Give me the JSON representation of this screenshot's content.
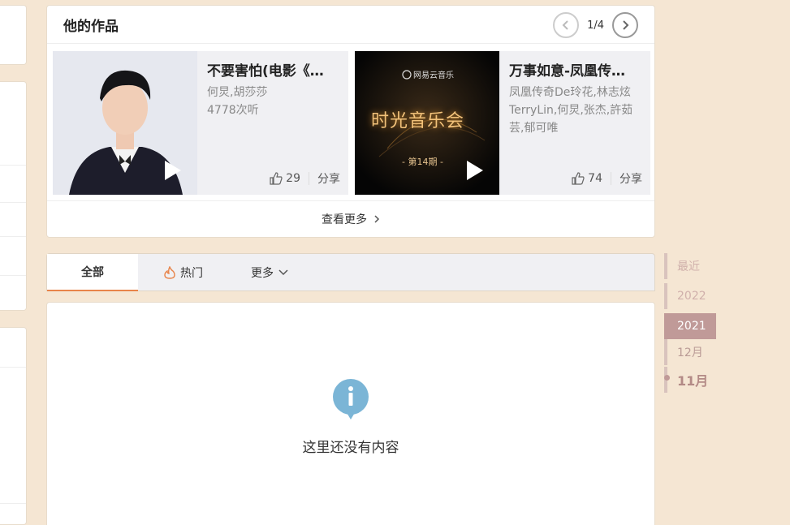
{
  "works": {
    "title": "他的作品",
    "page_indicator": "1/4",
    "items": [
      {
        "title": "不要害怕(电影《…",
        "meta_lines": [
          "何炅,胡莎莎",
          "4778次听"
        ],
        "likes": "29",
        "share_label": "分享"
      },
      {
        "title": "万事如意-凤凰传…",
        "meta_lines": [
          "凤凰传奇De玲花,林志炫",
          "TerryLin,何炅,张杰,許茹",
          "芸,郁可唯"
        ],
        "likes": "74",
        "share_label": "分享",
        "cover_lines": [
          "网易云音乐",
          "时光音乐会",
          "- 第14期 -"
        ]
      }
    ],
    "more_label": "查看更多"
  },
  "tabs": {
    "all_label": "全部",
    "hot_label": "热门",
    "more_label": "更多"
  },
  "empty": {
    "message": "这里还没有内容"
  },
  "timeline": {
    "items": [
      "最近",
      "2022",
      "2021",
      "12月",
      "11月"
    ],
    "active": "2021"
  },
  "colors": {
    "page_bg": "#f5e6d3",
    "accent": "#e8844a",
    "timeline_active": "#c09a98",
    "info_icon": "#7bb5d6"
  }
}
